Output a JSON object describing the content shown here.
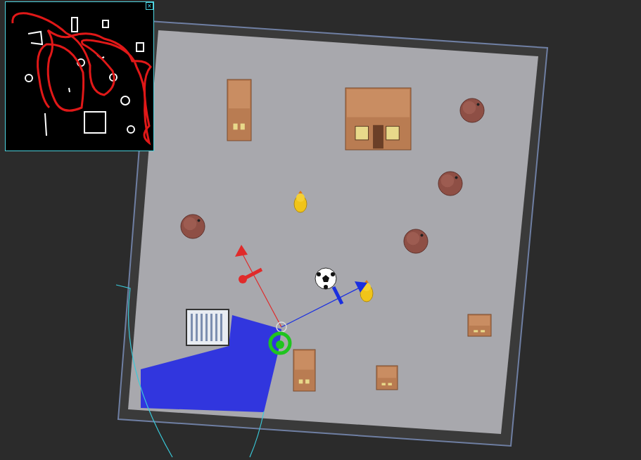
{
  "minimap": {
    "visible": true,
    "close_icon": "×"
  },
  "scene": {
    "objects": [
      {
        "kind": "cabinet"
      },
      {
        "kind": "house"
      },
      {
        "kind": "pot"
      },
      {
        "kind": "pot"
      },
      {
        "kind": "pot"
      },
      {
        "kind": "pot"
      },
      {
        "kind": "duck"
      },
      {
        "kind": "duck"
      },
      {
        "kind": "soccer-ball"
      },
      {
        "kind": "small-box"
      },
      {
        "kind": "small-box"
      },
      {
        "kind": "tall-box"
      },
      {
        "kind": "shelf"
      }
    ]
  },
  "robot": {
    "laser_scan_visible": true,
    "axes": [
      {
        "axis": "x",
        "color": "#e02a2a"
      },
      {
        "axis": "y",
        "color": "#1a2fe0"
      },
      {
        "axis": "z",
        "color": "#1fc41f"
      }
    ]
  }
}
